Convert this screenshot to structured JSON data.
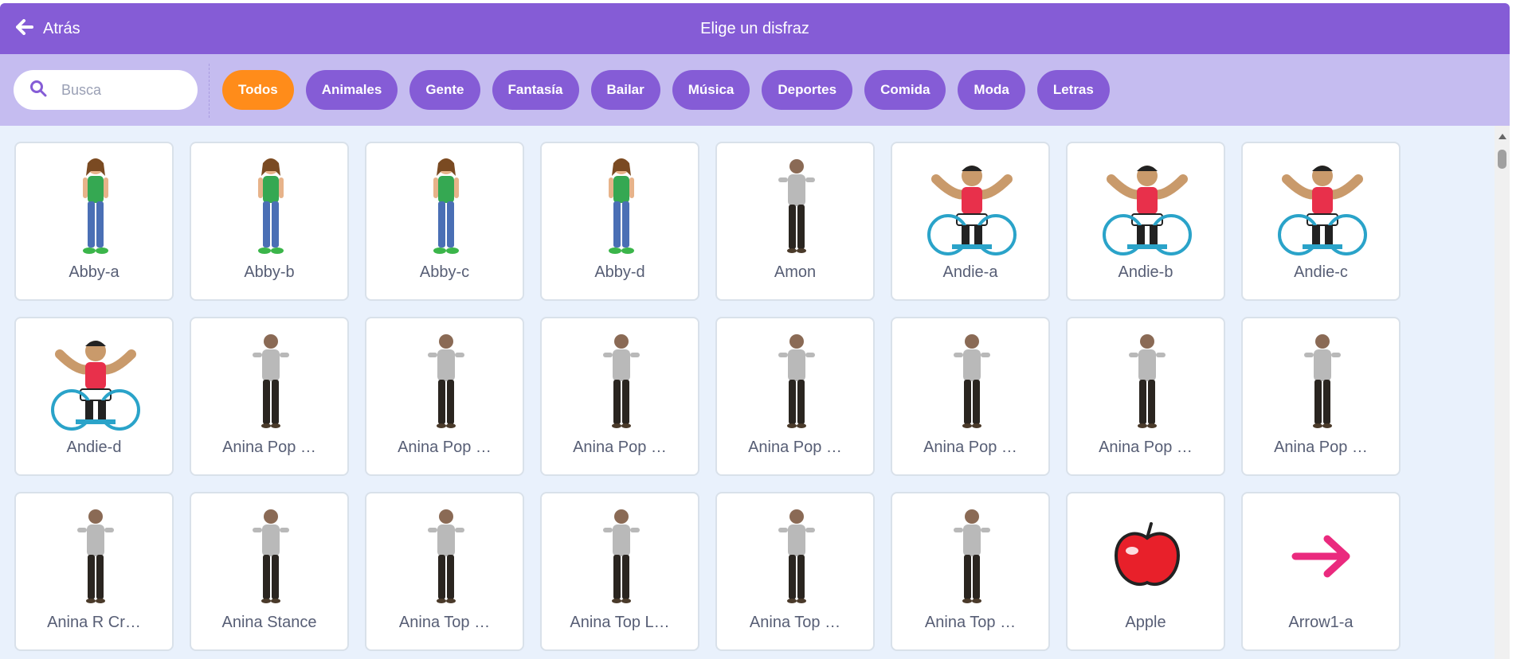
{
  "header": {
    "back_label": "Atrás",
    "title": "Elige un disfraz"
  },
  "search": {
    "placeholder": "Busca"
  },
  "tags": [
    "Todos",
    "Animales",
    "Gente",
    "Fantasía",
    "Bailar",
    "Música",
    "Deportes",
    "Comida",
    "Moda",
    "Letras"
  ],
  "costumes": [
    {
      "label": "Abby-a",
      "icon": "girl-figure"
    },
    {
      "label": "Abby-b",
      "icon": "girl-figure"
    },
    {
      "label": "Abby-c",
      "icon": "girl-figure"
    },
    {
      "label": "Abby-d",
      "icon": "girl-figure"
    },
    {
      "label": "Amon",
      "icon": "dancer-photo"
    },
    {
      "label": "Andie-a",
      "icon": "wheelchair-athlete"
    },
    {
      "label": "Andie-b",
      "icon": "wheelchair-athlete"
    },
    {
      "label": "Andie-c",
      "icon": "wheelchair-athlete"
    },
    {
      "label": "Andie-d",
      "icon": "wheelchair-athlete"
    },
    {
      "label": "Anina Pop …",
      "icon": "dancer-photo"
    },
    {
      "label": "Anina Pop …",
      "icon": "dancer-photo"
    },
    {
      "label": "Anina Pop …",
      "icon": "dancer-photo"
    },
    {
      "label": "Anina Pop …",
      "icon": "dancer-photo"
    },
    {
      "label": "Anina Pop …",
      "icon": "dancer-photo"
    },
    {
      "label": "Anina Pop …",
      "icon": "dancer-photo"
    },
    {
      "label": "Anina Pop …",
      "icon": "dancer-photo"
    },
    {
      "label": "Anina R Cr…",
      "icon": "dancer-photo"
    },
    {
      "label": "Anina Stance",
      "icon": "dancer-photo"
    },
    {
      "label": "Anina Top …",
      "icon": "dancer-photo"
    },
    {
      "label": "Anina Top L…",
      "icon": "dancer-photo"
    },
    {
      "label": "Anina Top …",
      "icon": "dancer-photo"
    },
    {
      "label": "Anina Top …",
      "icon": "dancer-photo"
    },
    {
      "label": "Apple",
      "icon": "apple-icon"
    },
    {
      "label": "Arrow1-a",
      "icon": "arrow-icon"
    }
  ],
  "colors": {
    "header": "#855cd6",
    "filterbar": "#c5bcf0",
    "active_tag": "#ff8c1a",
    "background": "#e9f1fc"
  }
}
